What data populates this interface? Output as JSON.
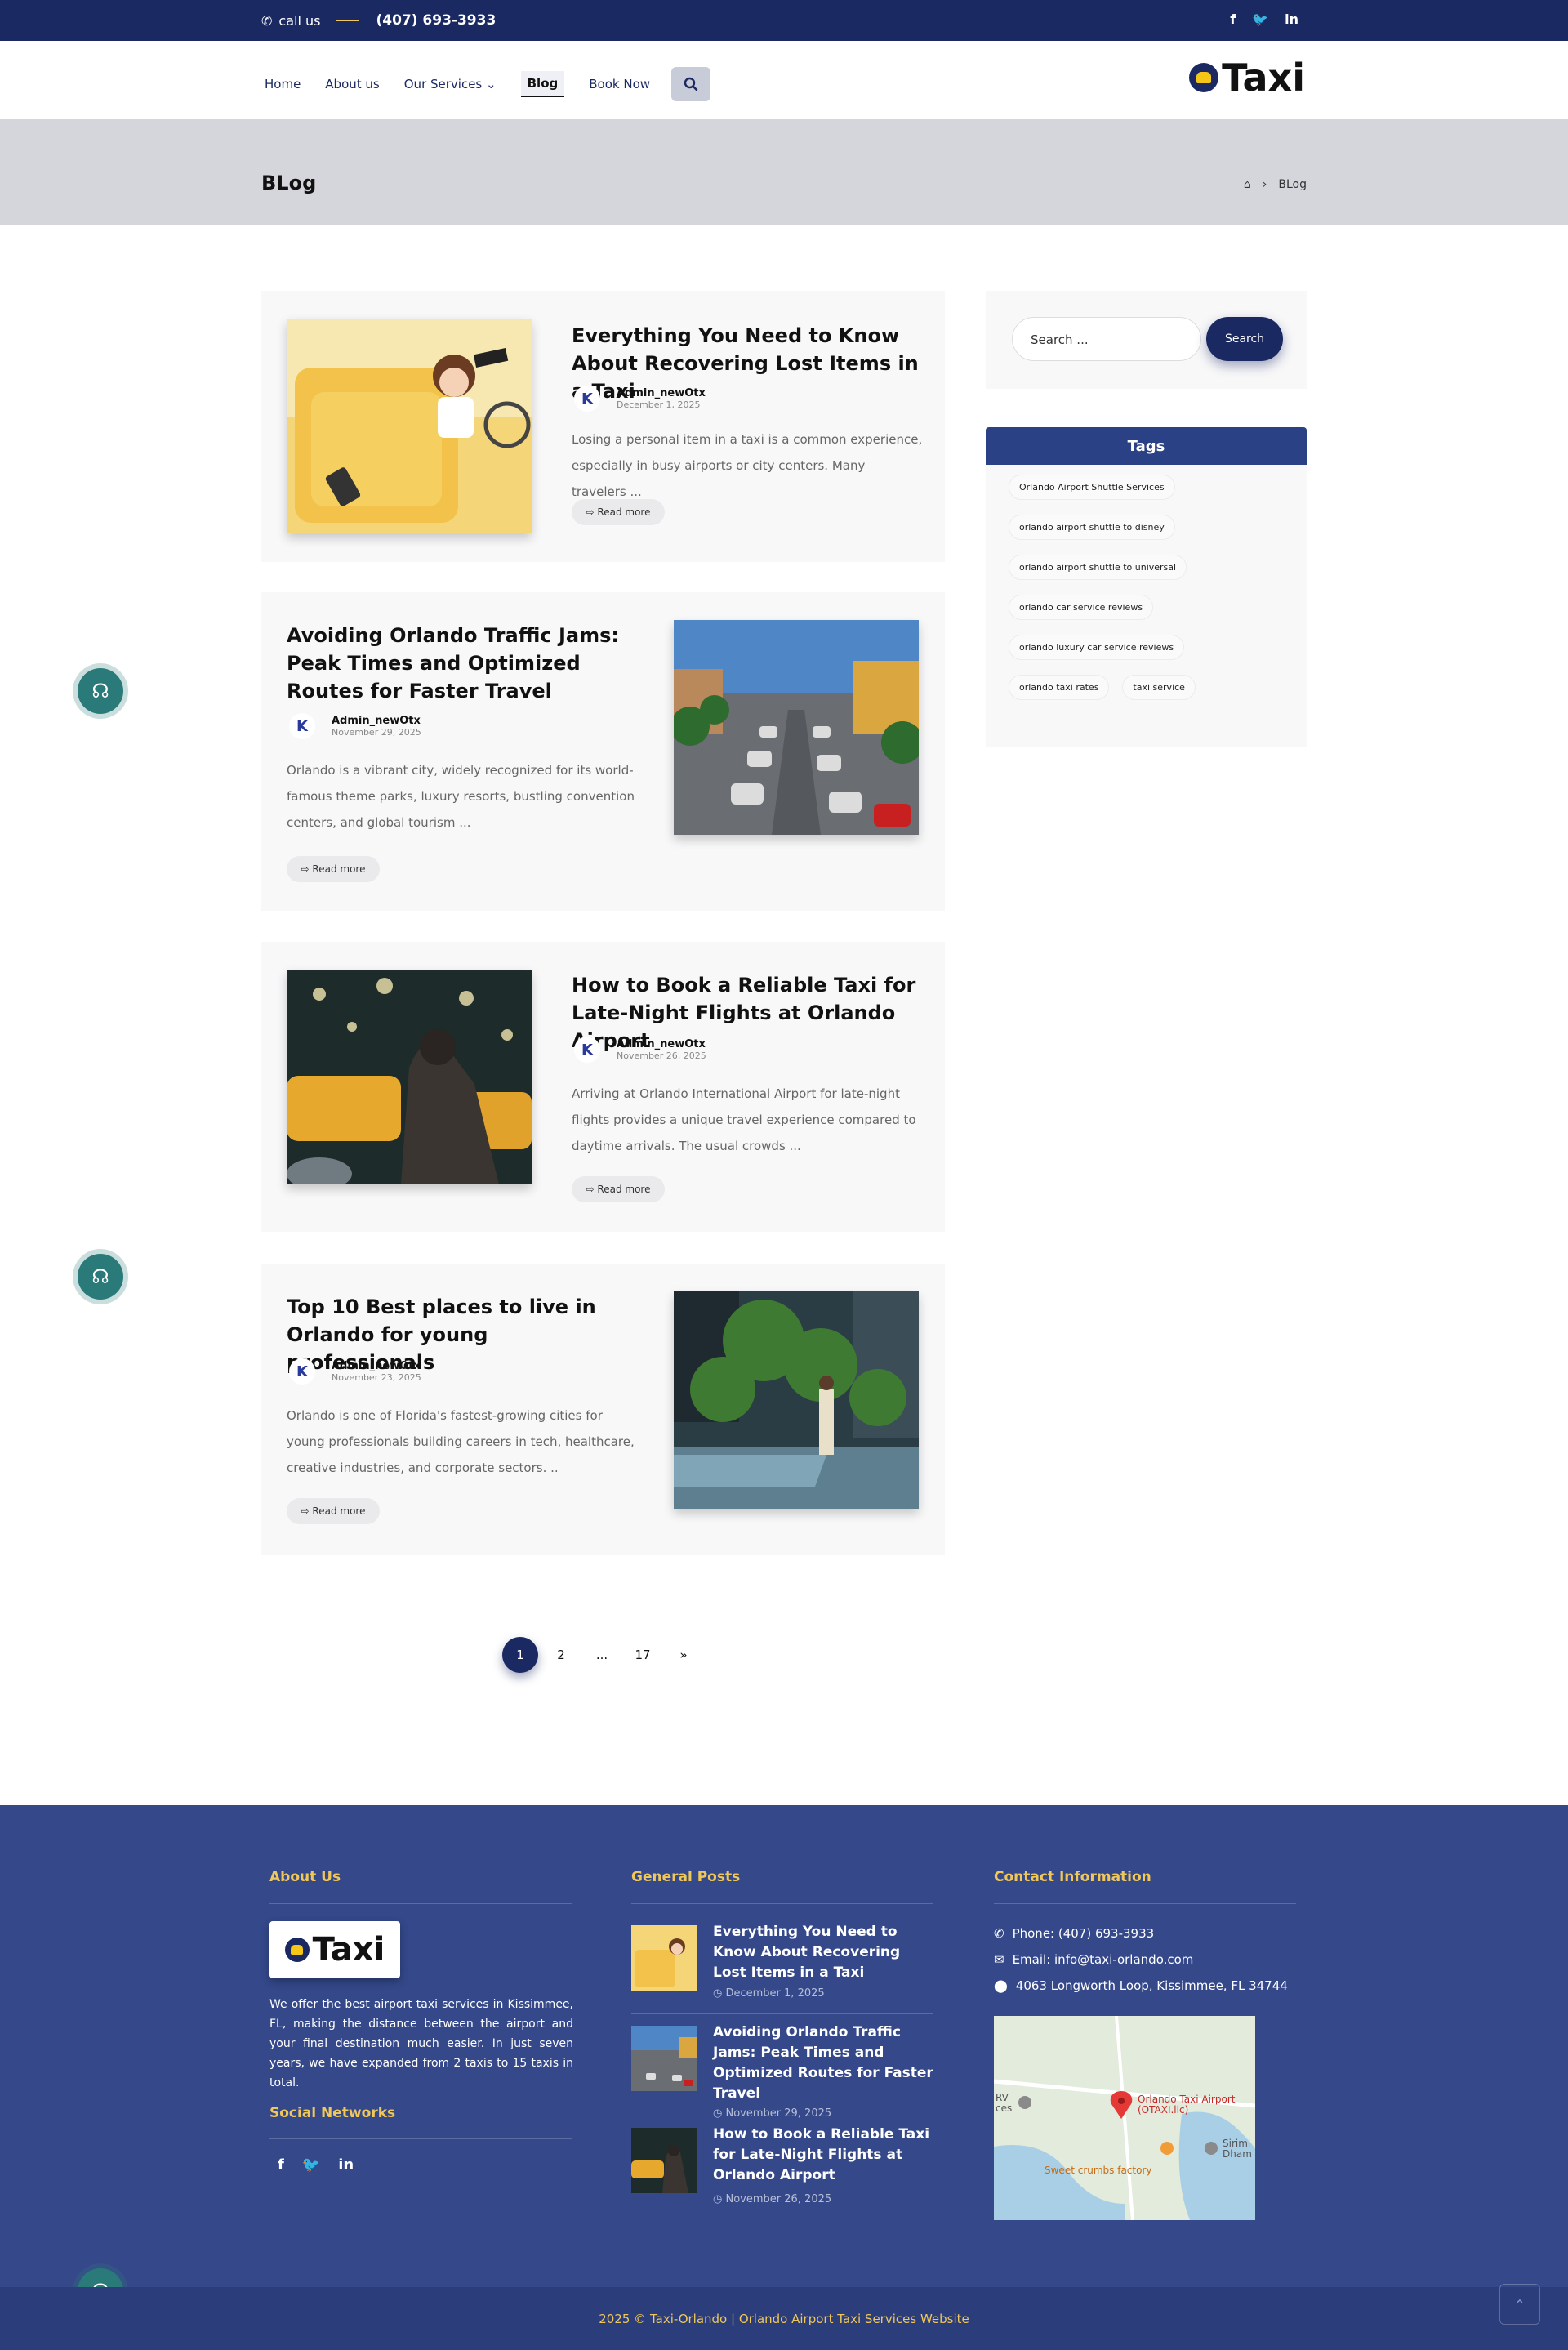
{
  "topbar": {
    "call_label": "call us",
    "phone": "(407) 693-3933"
  },
  "nav": {
    "home": "Home",
    "about": "About us",
    "services": "Our Services",
    "blog": "Blog",
    "book": "Book Now"
  },
  "logo": {
    "text": "Taxi"
  },
  "banner": {
    "title": "BLog",
    "breadcrumb_current": "BLog"
  },
  "posts": [
    {
      "title": "Everything You Need to Know About Recovering Lost Items in a Taxi",
      "author": "Admin_newOtx",
      "date": "December 1, 2025",
      "excerpt": "Losing a personal item in a taxi is a common experience, especially in busy airports or city centers. Many travelers ...",
      "more": "Read more"
    },
    {
      "title": "Avoiding Orlando Traffic Jams: Peak Times and Optimized Routes for Faster Travel",
      "author": "Admin_newOtx",
      "date": "November 29, 2025",
      "excerpt": "Orlando is a vibrant city, widely recognized for its world-famous theme parks, luxury resorts, bustling convention centers, and global tourism ...",
      "more": "Read more"
    },
    {
      "title": "How to Book a Reliable Taxi for Late-Night Flights at Orlando Airport",
      "author": "Admin_newOtx",
      "date": "November 26, 2025",
      "excerpt": "Arriving at Orlando International Airport for late-night flights provides a unique travel experience compared to daytime arrivals. The usual crowds ...",
      "more": "Read more"
    },
    {
      "title": "Top 10 Best places to live in Orlando for young professionals",
      "author": "Admin_newOtx",
      "date": "November 23, 2025",
      "excerpt": "Orlando is one of Florida's fastest-growing cities for young professionals building careers in tech, healthcare, creative industries, and corporate sectors. ..",
      "more": "Read more"
    }
  ],
  "sidebar": {
    "search_placeholder": "Search ...",
    "search_button": "Search",
    "tags_title": "Tags",
    "tags": [
      "Orlando Airport Shuttle Services",
      "orlando airport shuttle to disney",
      "orlando airport shuttle to universal",
      "orlando car service reviews",
      "orlando luxury car service reviews",
      "orlando taxi rates",
      "taxi service"
    ]
  },
  "pagination": [
    "1",
    "2",
    "...",
    "17",
    "»"
  ],
  "footer": {
    "about_title": "About Us",
    "about_text": "We offer the best airport taxi services in Kissimmee, FL, making the distance between the airport and your final destination much easier. In just seven years, we have expanded from 2 taxis to 15 taxis in total.",
    "social_title": "Social Networks",
    "posts_title": "General Posts",
    "posts": [
      {
        "title": "Everything You Need to Know About Recovering Lost Items in a Taxi",
        "date": "December 1, 2025"
      },
      {
        "title": "Avoiding Orlando Traffic Jams: Peak Times and Optimized Routes for Faster Travel",
        "date": "November 29, 2025"
      },
      {
        "title": "How to Book a Reliable Taxi for Late-Night Flights at Orlando Airport",
        "date": "November 26, 2025"
      }
    ],
    "contact_title": "Contact Information",
    "phone": "Phone: (407) 693-3933",
    "email": "Email: info@taxi-orlando.com",
    "address": "4063 Longworth Loop, Kissimmee, FL 34744",
    "map": {
      "pin_label": "Orlando Taxi Airport (OTAXI.llc)",
      "place2": "Sweet crumbs factory",
      "place3": "Sirimi Dham",
      "place4": "RV ces"
    },
    "copyright": "2025 © Taxi-Orlando | Orlando Airport Taxi Services Website"
  },
  "colors": {
    "navy": "#1b2963",
    "footer": "#34488a",
    "gold": "#f0c85a",
    "support": "#2a7a7a"
  }
}
